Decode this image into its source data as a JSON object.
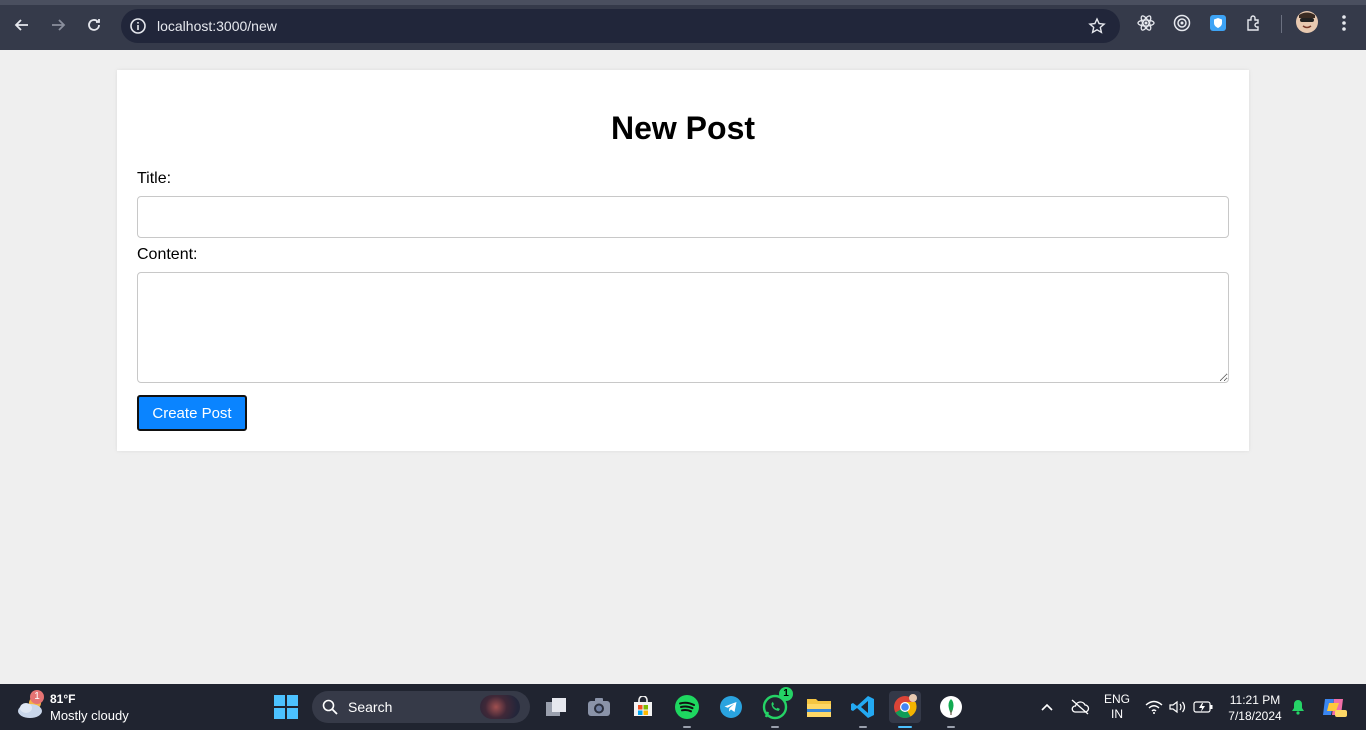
{
  "browser": {
    "url": "localhost:3000/new"
  },
  "page": {
    "heading": "New Post",
    "title_label": "Title:",
    "title_value": "",
    "content_label": "Content:",
    "content_value": "",
    "submit_label": "Create Post"
  },
  "taskbar": {
    "weather": {
      "temp": "81°F",
      "condition": "Mostly cloudy",
      "badge": "1"
    },
    "search_label": "Search",
    "whatsapp_badge": "1",
    "language": {
      "line1": "ENG",
      "line2": "IN"
    },
    "time": "11:21 PM",
    "date": "7/18/2024"
  },
  "colors": {
    "button": "#0a84ff",
    "browser_bg": "#353a4a",
    "taskbar_bg": "#202430"
  }
}
